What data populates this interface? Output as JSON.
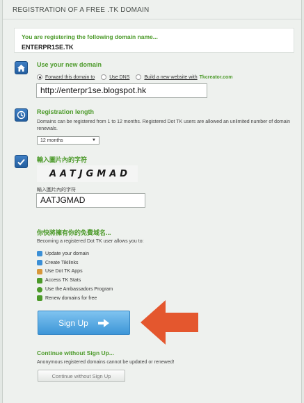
{
  "header": {
    "title": "REGISTRATION OF A FREE .TK DOMAIN"
  },
  "domain": {
    "intro": "You are registering the following domain name...",
    "name": "ENTERPR1SE.TK"
  },
  "use_domain": {
    "title": "Use your new domain",
    "options": [
      {
        "label": "Forward this domain to",
        "selected": true
      },
      {
        "label": "Use DNS",
        "selected": false
      },
      {
        "label": "Build a new website with",
        "selected": false
      }
    ],
    "tkcreator": "Tkcreator.com",
    "url_value": "http://enterpr1se.blogspot.hk"
  },
  "reg_length": {
    "title": "Registration length",
    "description": "Domains can be registered from 1 to 12 months. Registered Dot TK users are allowed an unlimited number of domain renewals.",
    "selected": "12 months"
  },
  "captcha": {
    "title": "輸入圖片內的字符",
    "image_text": "AATJGMAD",
    "input_label": "輸入圖片內的字符",
    "input_value": "AATJGMAD"
  },
  "benefits": {
    "title": "你快將擁有你的免費域名...",
    "intro": "Becoming a registered Dot TK user allows you to:",
    "items": [
      {
        "label": "Update your domain",
        "icon": "update-icon",
        "color": "#3b8fd6"
      },
      {
        "label": "Create Tikilinks",
        "icon": "link-icon",
        "color": "#3b8fd6"
      },
      {
        "label": "Use Dot TK Apps",
        "icon": "apps-icon",
        "color": "#d8973a"
      },
      {
        "label": "Access TK Stats",
        "icon": "stats-icon",
        "color": "#4c9a2a"
      },
      {
        "label": "Use the Ambassadors Program",
        "icon": "ambassador-icon",
        "color": "#4c9a2a"
      },
      {
        "label": "Renew domains for free",
        "icon": "renew-icon",
        "color": "#4c9a2a"
      }
    ]
  },
  "signup": {
    "label": "Sign Up"
  },
  "continue": {
    "title": "Continue without Sign Up...",
    "note": "Anonymous registered domains cannot be updated or renewed!",
    "button": "Continue without Sign Up"
  },
  "colors": {
    "accent_green": "#4c9a2a",
    "signup_blue": "#3d96d7",
    "arrow_orange": "#e4572e"
  }
}
